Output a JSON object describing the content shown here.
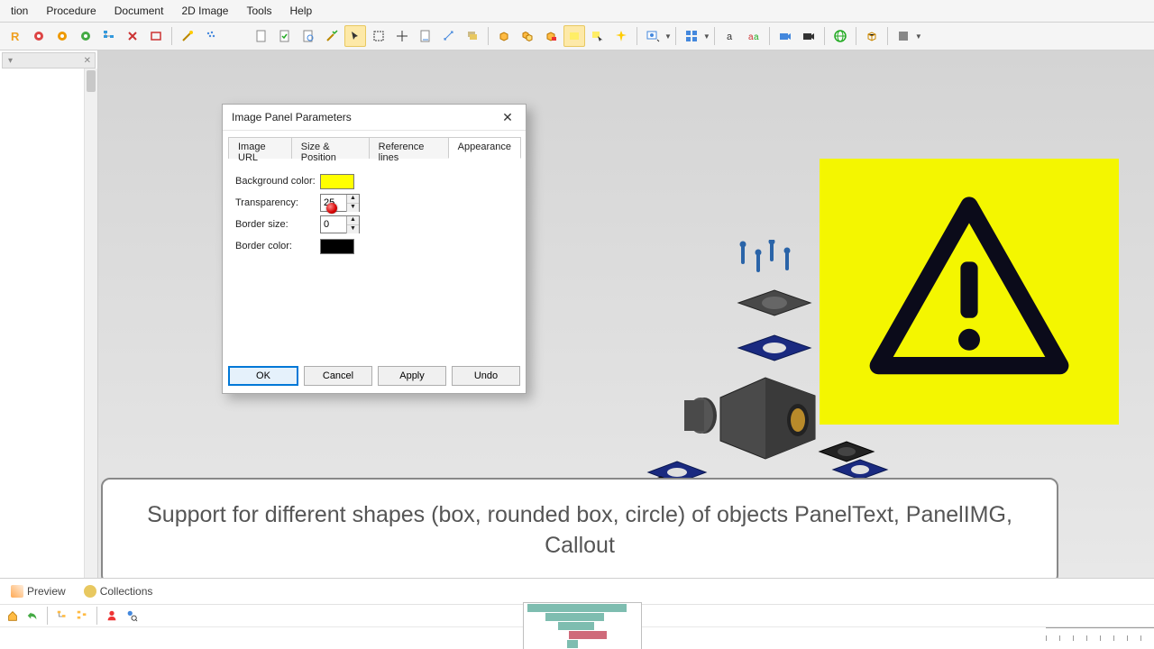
{
  "menus": [
    "tion",
    "Procedure",
    "Document",
    "2D Image",
    "Tools",
    "Help"
  ],
  "left_tabs": [
    "Preview",
    "Collections"
  ],
  "dialog": {
    "title": "Image Panel Parameters",
    "tabs": [
      "Image URL",
      "Size & Position",
      "Reference lines",
      "Appearance"
    ],
    "active_tab": 3,
    "fields": {
      "bgcolor_label": "Background color:",
      "bgcolor": "#ffff00",
      "transparency_label": "Transparency:",
      "transparency": "25",
      "bordersize_label": "Border size:",
      "bordersize": "0",
      "bordercolor_label": "Border color:",
      "bordercolor": "#000000"
    },
    "buttons": {
      "ok": "OK",
      "cancel": "Cancel",
      "apply": "Apply",
      "undo": "Undo"
    }
  },
  "caption_text": "Support for different shapes (box, rounded box, circle) of objects PanelText, PanelIMG, Callout",
  "toolbar_icons": [
    "reset",
    "gear-red",
    "gear-orange",
    "gear-green",
    "tree-blue",
    "x-tool",
    "rect-tool",
    "sep",
    "wand",
    "spray",
    "spacer",
    "page",
    "page-check",
    "page-search",
    "wand-check",
    "cursor-sel",
    "rect-sel",
    "crosshair",
    "page-measure",
    "measure",
    "stack",
    "sep",
    "cube-add",
    "cube-copy",
    "cube-lock",
    "mask-yellow",
    "mask-cursor",
    "spark",
    "sep",
    "dropdown1",
    "sep",
    "dropdown2",
    "sep",
    "a",
    "aa",
    "sep",
    "camera-blue",
    "camera-black",
    "sep",
    "globe",
    "sep",
    "box3d",
    "sep",
    "dropdown3"
  ]
}
